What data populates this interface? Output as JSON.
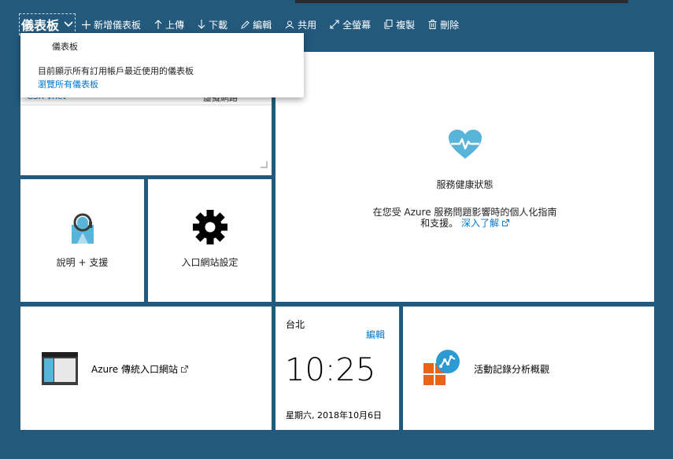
{
  "toolbar": {
    "dashboard_title": "儀表板",
    "new_dashboard": "新增儀表板",
    "upload": "上傳",
    "download": "下載",
    "edit": "編輯",
    "share": "共用",
    "fullscreen": "全螢幕",
    "clone": "複製",
    "delete": "刪除"
  },
  "dropdown": {
    "item": "儀表板",
    "description": "目前顯示所有訂用帳戶最近使用的儀表板",
    "browse_all": "瀏覽所有儀表板"
  },
  "resource_tile": {
    "partial_name": "CSX-vnet",
    "partial_type": "虛擬網路"
  },
  "service_health": {
    "title": "服務健康狀態",
    "description_line1": "在您受 Azure 服務問題影響時的個人化指南",
    "description_line2": "和支援。",
    "learn_more": "深入了解",
    "icon_color": "#59b4d9"
  },
  "help_tile": {
    "label": "說明 + 支援"
  },
  "portal_settings_tile": {
    "label": "入口網站設定"
  },
  "classic_portal_tile": {
    "label": "Azure 傳統入口網站"
  },
  "clock_tile": {
    "city": "台北",
    "edit": "編輯",
    "time": "10:25",
    "date": "星期六, 2018年10月6日"
  },
  "activity_log_tile": {
    "label": "活動記錄分析概觀",
    "orange": "#e4651c",
    "blue": "#2c9ad4"
  }
}
